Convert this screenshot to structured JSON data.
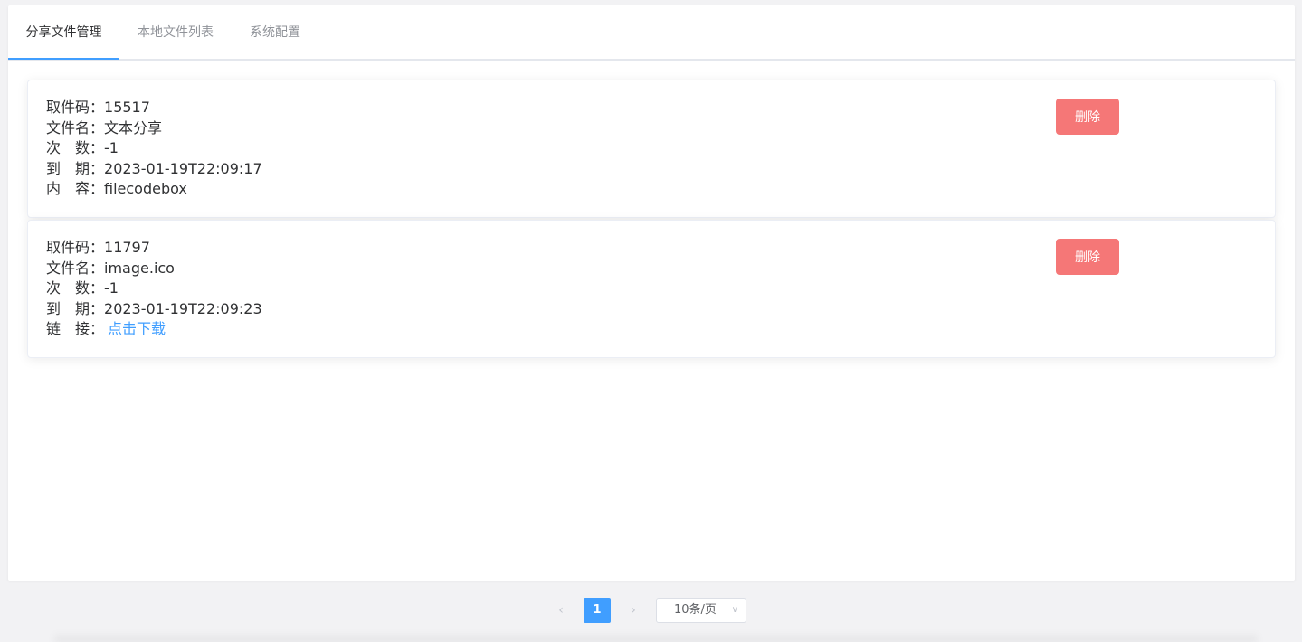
{
  "tabs": [
    {
      "label": "分享文件管理",
      "active": true
    },
    {
      "label": "本地文件列表",
      "active": false
    },
    {
      "label": "系统配置",
      "active": false
    }
  ],
  "cards": [
    {
      "code_label": "取件码：",
      "code": "15517",
      "name_label": "文件名：",
      "name": "文本分享",
      "count_label": "次　数：",
      "count": "-1",
      "expire_label": "到　期：",
      "expire": "2023-01-19T22:09:17",
      "content_label": "内　容：",
      "content": "filecodebox",
      "delete_label": "删除"
    },
    {
      "code_label": "取件码：",
      "code": "11797",
      "name_label": "文件名：",
      "name": "image.ico",
      "count_label": "次　数：",
      "count": "-1",
      "expire_label": "到　期：",
      "expire": "2023-01-19T22:09:23",
      "link_label": "链　接：",
      "link_text": "点击下载",
      "delete_label": "删除"
    }
  ],
  "pagination": {
    "prev_icon": "‹",
    "current_page": "1",
    "next_icon": "›",
    "page_size": "10条/页",
    "page_size_arrow": "∨"
  },
  "colors": {
    "accent": "#409eff",
    "danger": "#f56c6c"
  }
}
